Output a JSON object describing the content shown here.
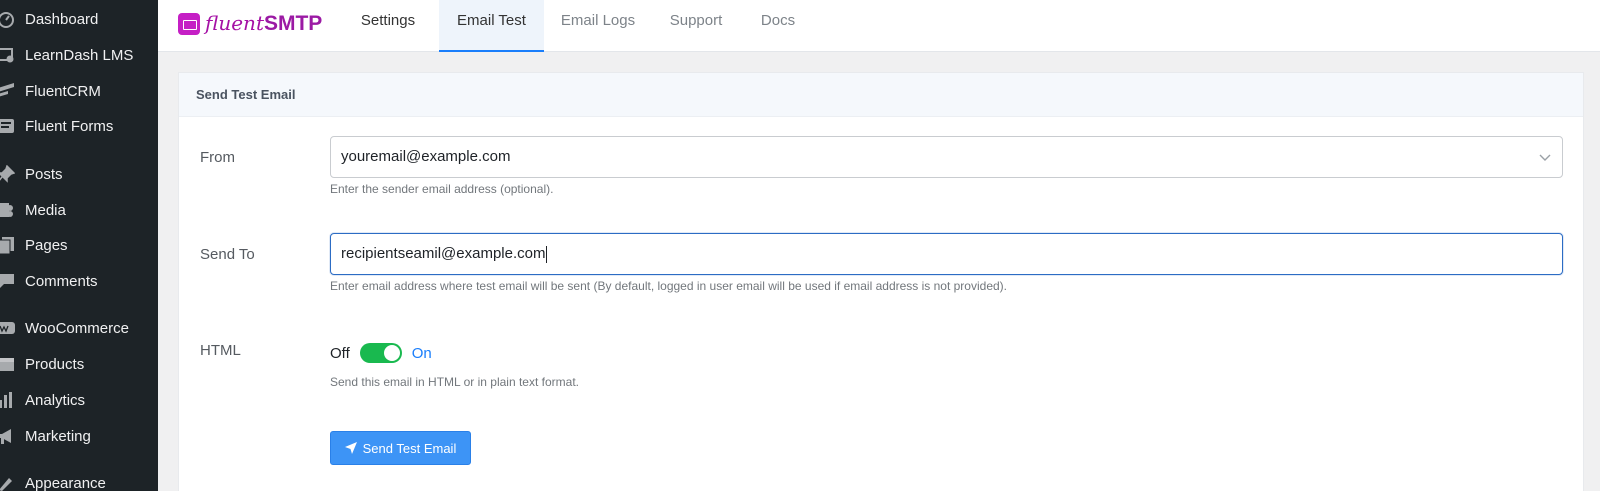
{
  "sidebar": {
    "items": [
      {
        "label": "Dashboard",
        "icon": "dashboard-icon"
      },
      {
        "label": "LearnDash LMS",
        "icon": "learndash-icon"
      },
      {
        "label": "FluentCRM",
        "icon": "fluentcrm-icon"
      },
      {
        "label": "Fluent Forms",
        "icon": "fluent-forms-icon"
      },
      {
        "label": "Posts",
        "icon": "pin-icon"
      },
      {
        "label": "Media",
        "icon": "media-icon"
      },
      {
        "label": "Pages",
        "icon": "pages-icon"
      },
      {
        "label": "Comments",
        "icon": "comment-icon"
      },
      {
        "label": "WooCommerce",
        "icon": "woocommerce-icon"
      },
      {
        "label": "Products",
        "icon": "products-icon"
      },
      {
        "label": "Analytics",
        "icon": "analytics-icon"
      },
      {
        "label": "Marketing",
        "icon": "megaphone-icon"
      },
      {
        "label": "Appearance",
        "icon": "appearance-icon"
      }
    ]
  },
  "header": {
    "logo_prefix": "fluent",
    "logo_suffix": "SMTP",
    "tabs": [
      {
        "label": "Settings"
      },
      {
        "label": "Email Test"
      },
      {
        "label": "Email Logs"
      },
      {
        "label": "Support"
      },
      {
        "label": "Docs"
      }
    ],
    "active_tab": "Email Test"
  },
  "card": {
    "title": "Send Test Email",
    "from": {
      "label": "From",
      "value": "youremail@example.com",
      "help": "Enter the sender email address (optional)."
    },
    "send_to": {
      "label": "Send To",
      "value": "recipientseamil@example.com",
      "help": "Enter email address where test email will be sent (By default, logged in user email will be used if email address is not provided)."
    },
    "html": {
      "label": "HTML",
      "off_label": "Off",
      "on_label": "On",
      "enabled": true,
      "help": "Send this email in HTML or in plain text format."
    },
    "submit_label": "Send Test Email"
  },
  "colors": {
    "accent": "#1a7efb",
    "toggle_on": "#19b94f",
    "sidebar_bg": "#1d2327",
    "brand": "#a511a5"
  }
}
